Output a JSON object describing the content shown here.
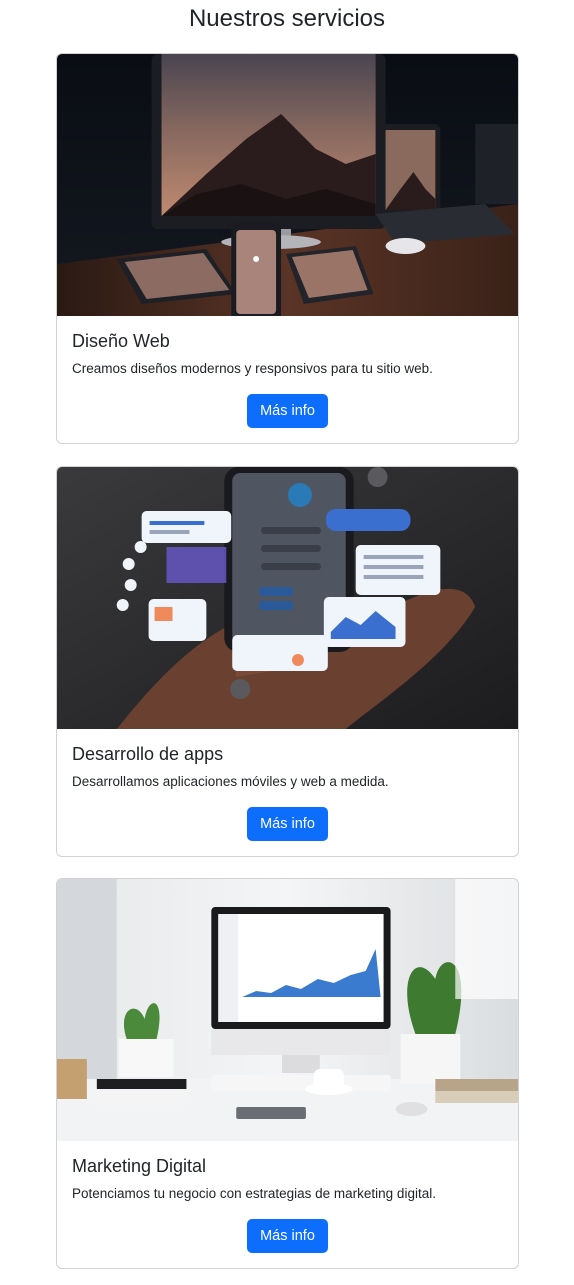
{
  "page": {
    "title": "Nuestros servicios"
  },
  "services": [
    {
      "title": "Diseño Web",
      "description": "Creamos diseños modernos y responsivos para tu sitio web.",
      "button_label": "Más info",
      "image_alt": "Dispositivos con pantallas mostrando montañas"
    },
    {
      "title": "Desarrollo de apps",
      "description": "Desarrollamos aplicaciones móviles y web a medida.",
      "button_label": "Más info",
      "image_alt": "Manos sosteniendo un teléfono con interfaces de app"
    },
    {
      "title": "Marketing Digital",
      "description": "Potenciamos tu negocio con estrategias de marketing digital.",
      "button_label": "Más info",
      "image_alt": "Escritorio con ordenador mostrando analíticas"
    }
  ],
  "colors": {
    "primary": "#0d6efd",
    "text": "#212529",
    "border": "#dee2e6"
  }
}
